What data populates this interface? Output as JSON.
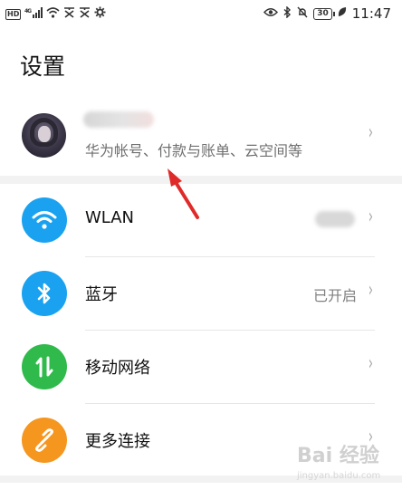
{
  "statusbar": {
    "hd": "HD",
    "signal": "⁴⁶ᵢₗₗ",
    "left_icons": [
      "wifi-icon",
      "notification-icon",
      "notification-icon",
      "settings-icon"
    ],
    "right_icons": [
      "eye-icon",
      "bluetooth-icon",
      "silent-icon"
    ],
    "battery": "30",
    "time": "11:47"
  },
  "header": {
    "title": "设置"
  },
  "account": {
    "subtitle": "华为帐号、付款与账单、云空间等"
  },
  "rows": [
    {
      "label": "WLAN",
      "value": "",
      "icon": "wifi-icon",
      "color": "#1aa2f0"
    },
    {
      "label": "蓝牙",
      "value": "已开启",
      "icon": "bluetooth-icon",
      "color": "#1aa2f0"
    },
    {
      "label": "移动网络",
      "value": "",
      "icon": "mobile-data-icon",
      "color": "#2fba4b"
    },
    {
      "label": "更多连接",
      "value": "",
      "icon": "link-icon",
      "color": "#f5961e"
    }
  ],
  "chevron": "›",
  "annotation": {
    "color": "#e02a2a"
  },
  "watermark": {
    "text": "Bai 经验",
    "sub": "jingyan.baidu.com"
  }
}
